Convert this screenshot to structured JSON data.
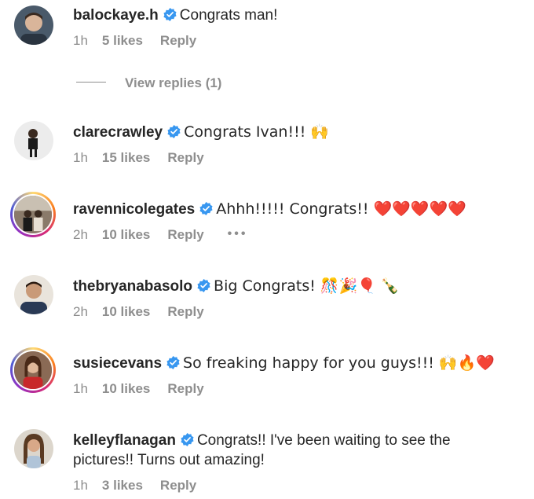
{
  "comments": [
    {
      "username": "balockaye.h",
      "text": "Congrats man!",
      "time": "1h",
      "likes": "5 likes",
      "reply": "Reply"
    },
    {
      "username": "clarecrawley",
      "text": "Congrats Ivan!!! 🙌",
      "time": "1h",
      "likes": "15 likes",
      "reply": "Reply"
    },
    {
      "username": "ravennicolegates",
      "text": "Ahhh!!!!! Congrats!! ❤️❤️❤️❤️❤️",
      "time": "2h",
      "likes": "10 likes",
      "reply": "Reply",
      "more": "•••"
    },
    {
      "username": "thebryanabasolo",
      "text": "Big Congrats! 🎊🎉🎈 🍾",
      "time": "2h",
      "likes": "10 likes",
      "reply": "Reply"
    },
    {
      "username": "susiecevans",
      "text": "So freaking happy for you guys!!! 🙌🔥❤️",
      "time": "1h",
      "likes": "10 likes",
      "reply": "Reply"
    },
    {
      "username": "kelleyflanagan",
      "text": "Congrats!! I've been waiting to see the pictures!! Turns out amazing!",
      "time": "1h",
      "likes": "3 likes",
      "reply": "Reply"
    }
  ],
  "view_replies": "View replies (1)",
  "colors": {
    "verified": "#3897f0",
    "meta": "#8e8e8e",
    "text": "#262626"
  },
  "icons": {
    "verified": "verified-badge-icon",
    "more": "more-options-icon"
  }
}
